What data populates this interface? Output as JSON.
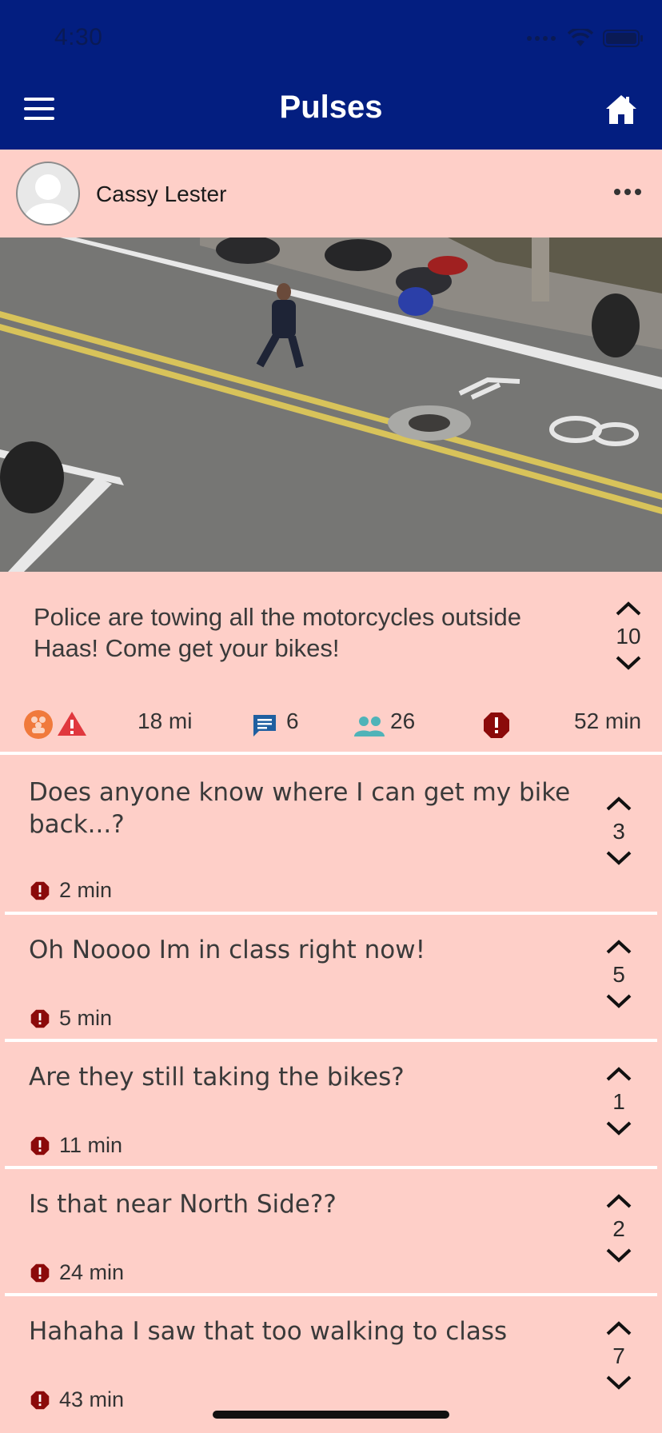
{
  "status_bar": {
    "time": "4:30"
  },
  "nav": {
    "title": "Pulses"
  },
  "post": {
    "author": "Cassy Lester",
    "text": "Police are towing all the motorcycles outside Haas! Come get your bikes!",
    "votes": "10",
    "distance": "18 mi",
    "comments_count": "6",
    "participants_count": "26",
    "time": "52 min"
  },
  "comments": [
    {
      "text": "Does anyone know where I can get my bike back...?",
      "time": "2 min",
      "votes": "3"
    },
    {
      "text": "Oh Noooo Im in class right now!",
      "time": "5 min",
      "votes": "5"
    },
    {
      "text": "Are they still taking the bikes?",
      "time": "11 min",
      "votes": "1"
    },
    {
      "text": "Is that near North Side??",
      "time": "24 min",
      "votes": "2"
    },
    {
      "text": "Hahaha I saw that too walking to class",
      "time": "43 min",
      "votes": "7"
    }
  ],
  "colors": {
    "header": "#031E80",
    "background": "#FECFC8",
    "alert": "#8B0A0A",
    "comment_icon": "#1F5FA0",
    "people_icon": "#4FB3B8"
  },
  "icons": {
    "menu": "hamburger-icon",
    "home": "home-icon",
    "more": "ellipsis-icon",
    "group": "group-badge-icon",
    "warning": "warning-triangle-icon",
    "comments": "chat-bubble-icon",
    "people": "people-icon",
    "alert": "alert-octagon-icon"
  }
}
